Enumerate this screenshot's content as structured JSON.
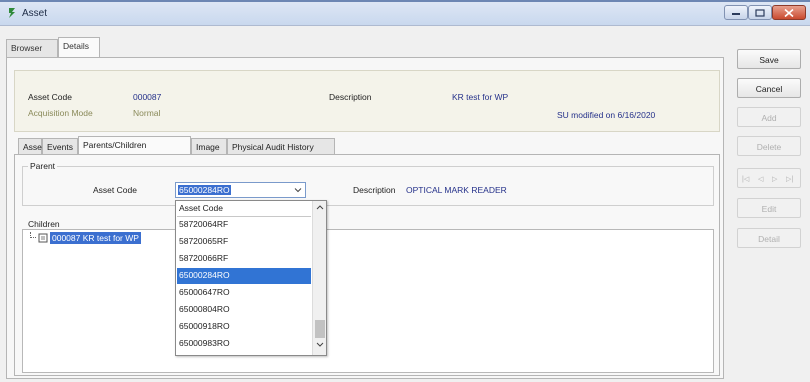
{
  "window": {
    "title": "Asset"
  },
  "tabs": [
    {
      "label": "Browser",
      "active": false
    },
    {
      "label": "Details",
      "active": true
    }
  ],
  "header": {
    "asset_code_label": "Asset Code",
    "asset_code": "000087",
    "acquisition_mode_label": "Acquisition Mode",
    "acquisition_mode": "Normal",
    "description_label": "Description",
    "description": "KR test for WP",
    "modified": "SU modified on 6/16/2020"
  },
  "inner_tabs": [
    {
      "label": "Asset"
    },
    {
      "label": "Events"
    },
    {
      "label": "Parents/Children",
      "active": true
    },
    {
      "label": "Image"
    },
    {
      "label": "Physical Audit History"
    }
  ],
  "parent": {
    "legend": "Parent",
    "asset_code_label": "Asset Code",
    "asset_code_value": "65000284RO",
    "description_label": "Description",
    "description_value": "OPTICAL MARK READER"
  },
  "children": {
    "legend": "Children",
    "items": [
      {
        "label": "000087 KR test for WP"
      }
    ]
  },
  "dropdown": {
    "header": "Asset Code",
    "options": [
      "58720064RF",
      "58720065RF",
      "58720066RF",
      "65000284RO",
      "65000647RO",
      "65000804RO",
      "65000918RO",
      "65000983RO"
    ],
    "selected": "65000284RO"
  },
  "side_buttons": {
    "save": "Save",
    "cancel": "Cancel",
    "add": "Add",
    "delete": "Delete",
    "edit": "Edit",
    "detail": "Detail",
    "nav": [
      "|◁",
      "◁",
      "▷",
      "▷|"
    ]
  },
  "colors": {
    "selection": "#3174d4",
    "value_text": "#25318a",
    "close_button": "#c94a2f"
  }
}
